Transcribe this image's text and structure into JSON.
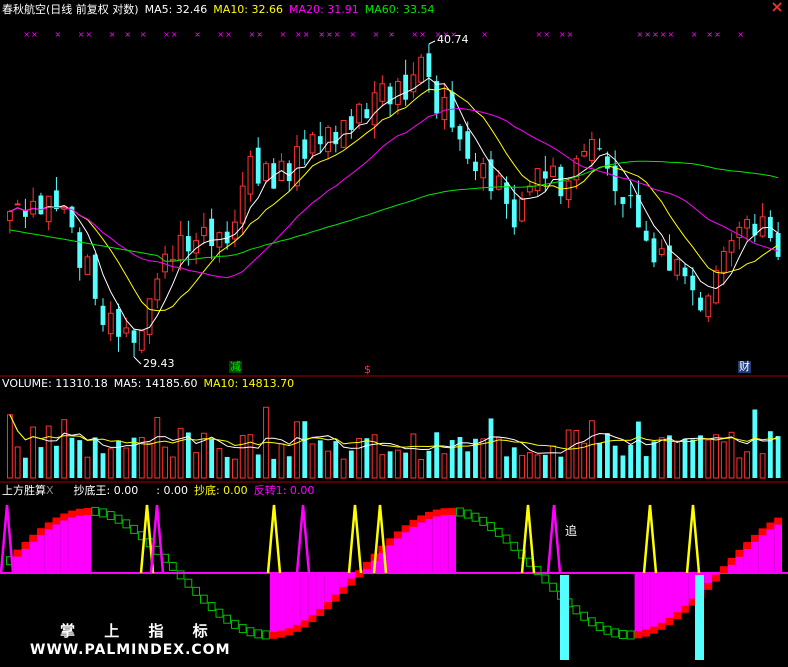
{
  "header": {
    "stock_name": "春秋航空(日线 前复权 对数)",
    "ma5_label": "MA5: 32.46",
    "ma10_label": "MA10: 32.66",
    "ma20_label": "MA20: 31.91",
    "ma60_label": "MA60: 33.54"
  },
  "volume_header": {
    "volume_label": "VOLUME: 11310.18",
    "ma5_label": "MA5: 14185.60",
    "ma10_label": "MA10: 14813.70"
  },
  "indicator_header": {
    "name": "上方胜算",
    "x_mark": "X",
    "chaodiwang_label": "抄底王: 0.00",
    "blank_label": ": 0.00",
    "chaodi_label": "抄底: 0.00",
    "fanzhuan_label": "反转1: 0.00"
  },
  "annotations": {
    "high_label": "40.74",
    "low_label": "29.43",
    "jian_marker": "减",
    "dollar_marker": "$",
    "cai_marker": "财",
    "zhui_marker": "追"
  },
  "watermark": {
    "line1": "掌 上 指 标",
    "line2": "WWW.PALMINDEX.COM"
  },
  "colors": {
    "up": "#ff3232",
    "down": "#54ffff",
    "ma5": "#ffffff",
    "ma10": "#ffff00",
    "ma20": "#ff00ff",
    "ma60": "#00e600",
    "magenta_fill": "#ff00ff",
    "red_fill": "#ff0000",
    "yellow_fill": "#ffff00"
  },
  "chart_data": {
    "type": "candlestick",
    "series": [
      {
        "name": "MA5"
      },
      {
        "name": "MA10"
      },
      {
        "name": "MA20"
      },
      {
        "name": "MA60"
      },
      {
        "name": "VOLUME"
      }
    ],
    "closes": [
      34.2,
      34.5,
      34.0,
      34.6,
      34.1,
      34.8,
      34.3,
      34.4,
      33.6,
      32.1,
      32.5,
      31.0,
      30.1,
      30.5,
      29.7,
      30.0,
      29.5,
      29.9,
      31.0,
      31.7,
      32.6,
      32.4,
      33.3,
      32.7,
      33.1,
      33.6,
      32.9,
      33.4,
      33.0,
      33.8,
      35.2,
      36.4,
      35.3,
      36.1,
      35.1,
      36.2,
      35.4,
      36.8,
      36.3,
      37.3,
      36.9,
      37.6,
      36.9,
      37.9,
      37.5,
      38.6,
      38.0,
      39.1,
      39.5,
      38.6,
      39.6,
      38.8,
      39.9,
      40.7,
      39.8,
      38.2,
      38.9,
      37.6,
      37.1,
      36.3,
      35.8,
      36.1,
      35.0,
      35.6,
      34.5,
      33.6,
      34.7,
      35.2,
      35.9,
      35.5,
      36.0,
      34.8,
      35.4,
      36.3,
      36.6,
      37.1,
      36.7,
      35.9,
      35.0,
      34.5,
      34.8,
      33.6,
      33.1,
      32.3,
      32.8,
      32.0,
      32.4,
      31.8,
      31.3,
      30.6,
      31.1,
      32.0,
      32.7,
      33.1,
      33.6,
      33.9,
      33.3,
      34.0,
      33.2,
      32.5
    ],
    "volume_ma5": 14185.6,
    "volume_ma10": 14813.7
  }
}
